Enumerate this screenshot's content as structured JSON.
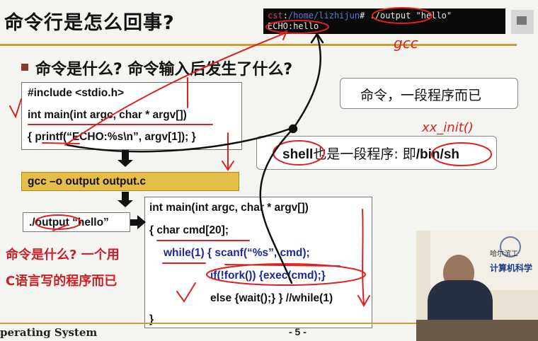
{
  "slide": {
    "title": "命令行是怎么回事?",
    "bullet": "命令是什么? 命令输入后发生了什么?",
    "code_box": {
      "lines": [
        "#include <stdio.h>",
        "int main(int argc, char * argv[])",
        "{  printf(“ECHO:%s\\n”, argv[1]); }"
      ]
    },
    "gcc_command": "gcc –o output output.c",
    "run_command": "./output “hello”",
    "shell_code": {
      "lines": [
        "int main(int argc, char * argv[])",
        "{  char cmd[20];",
        "while(1)  { scanf(“%s”, cmd);",
        "if(!fork()) {exec(cmd);}",
        "else {wait();}  }  //while(1)",
        "}"
      ]
    },
    "bubble_command": "命令，一段程序而已",
    "bubble_shell": {
      "shell": "shell",
      "middle": "也是一段程序: 即",
      "path": "/bin/sh"
    },
    "left_note": {
      "line1": "命令是什么? 一个用",
      "line2": "C语言写的程序而已"
    }
  },
  "terminal": {
    "user": "cst",
    "path": "/home/lizhijun",
    "prompt_end": "#",
    "command": " ./output \"hello\"",
    "output": "ECHO:hello"
  },
  "handwriting": {
    "gcc_note": "gcc",
    "init_note": "xx_init()"
  },
  "footer": {
    "course": "perating System",
    "page": "- 5 -"
  },
  "video": {
    "school": "哈尔滨工",
    "dept": "计算机科学"
  },
  "colors": {
    "accent_gold": "#e7bd4a",
    "ink_red": "#e02020",
    "code_blue": "#1a2a9a",
    "note_red": "#c8202a"
  }
}
